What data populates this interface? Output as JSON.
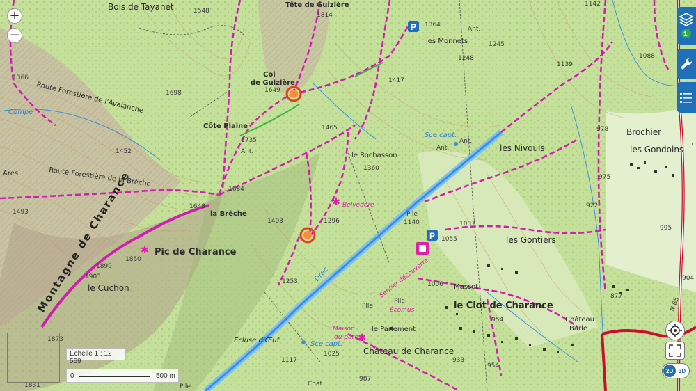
{
  "map": {
    "places": {
      "bois_tayanet": "Bois de Tayanet",
      "tete_guiziere": "Tête de Guizière",
      "col_guiziere_1": "Col",
      "col_guiziere_2": "de Guizière",
      "les_monnets": "les Monnets",
      "cote_plaine": "Côte Plaine",
      "ant1": "Ant.",
      "ant2": "Ant.",
      "ant3": "Ant.",
      "ant4": "Ant.",
      "le_rochasson": "le Rochasson",
      "les_nivouls": "les Nivouls",
      "brochier": "Brochier",
      "les_gondoins": "les Gondoins",
      "ares": "Ares",
      "belvedere": "Belvédère",
      "la_breche": "la Brèche",
      "pic_charance": "Pic de Charance",
      "les_gontiers": "les Gontiers",
      "le_cuchon": "le Cuchon",
      "massot": "Massot",
      "le_clot": "le Clot de Charance",
      "chateau_barle_1": "Château",
      "chateau_barle_2": "Barle",
      "le_pariement": "le Pariement",
      "chateau_charance": "Château de Charance",
      "ecluse": "Écluse d'Œuf",
      "sce_capt1": "Sce capt.",
      "sce_capt2": "Sce capt.",
      "pile1": "Plle",
      "pile2": "Plle",
      "pile3": "Plle",
      "pile4": "Plle",
      "chat": "Chât",
      "maison_1": "Maison",
      "maison_2": "du parc",
      "ecomus": "Écomus",
      "sentier": "Sentier découverte",
      "compe": "Compe",
      "n85": "N 85",
      "p_cut": "P"
    },
    "roads": {
      "route_avalanche": "Route Forestière de l'Avalanche",
      "route_breche": "Route Forestière de la Brèche",
      "ridge": "Montagne de Charance"
    },
    "altitudes": {
      "a1548": "1548",
      "a1814": "1814",
      "a1364": "1364",
      "a1142": "1142",
      "a1366": "1366",
      "a1649": "1649",
      "a1698": "1698",
      "a1245": "1245",
      "a1248": "1248",
      "a1417": "1417",
      "a1139": "1139",
      "a1088": "1088",
      "a1465": "1465",
      "a1735": "1735",
      "a1452": "1452",
      "a1360": "1360",
      "a978": "978",
      "a1684": "1684",
      "a1648": "1648",
      "a975": "975",
      "a1493": "1493",
      "a1403": "1403",
      "a1296": "1296",
      "a1140": "1140",
      "a1037": "1037",
      "a922": "922",
      "a995": "995",
      "a1055": "1055",
      "a1850": "1850",
      "a1899": "1899",
      "a1903": "1903",
      "a1253": "1253",
      "a1006": "1006",
      "a904": "904",
      "a877": "877",
      "a954a": "954",
      "a954b": "954",
      "a933": "933",
      "a1873": "1873",
      "a1025": "1025",
      "a987": "987",
      "a1117": "1117",
      "a1831": "1831"
    },
    "water": {
      "drac": "Drac",
      "sce_capt_n": "Sce capt.",
      "ant_water": "Ant."
    }
  },
  "controls": {
    "zoom_in": "+",
    "zoom_out": "−",
    "layers_badge": "1",
    "scale_label": "Échelle 1 : 12 569",
    "scale_zero": "0",
    "scale_end": "500 m",
    "btn_2d": "2D",
    "btn_3d": "3D"
  },
  "colors": {
    "trail": "#d01fb0",
    "road": "#c8102e",
    "water": "#3a8fe0",
    "forest": "#b8d98a",
    "accent": "#1f70b8"
  }
}
